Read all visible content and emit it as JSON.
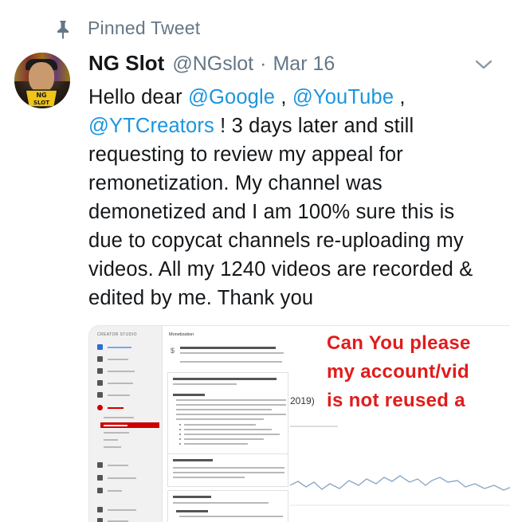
{
  "pinned": {
    "label": "Pinned Tweet",
    "icon": "pin-icon"
  },
  "tweet": {
    "author": {
      "name": "NG Slot",
      "handle": "@NGslot",
      "avatar_logo_text_top": "NG",
      "avatar_logo_text_bottom": "SLOT"
    },
    "separator": "·",
    "date": "Mar 16",
    "menu_icon": "chevron-down-icon",
    "text": {
      "greeting": "Hello dear ",
      "mention_1": "@Google",
      "sep_1": " , ",
      "mention_2": "@YouTube",
      "sep_2": " ,",
      "mention_3": "@YTCreators",
      "body": " ! 3 days later and still requesting to review my appeal for remonetization. My channel was demonetized and I am 100% sure this is due to copycat channels re-uploading my videos. All my 1240 videos are recorded & edited by me. Thank you"
    }
  },
  "media": {
    "sidebar_title": "CREATOR STUDIO",
    "main_heading": "Monetization",
    "year_label": "2019)",
    "overlay_lines": [
      "Can You please",
      "my account/vid",
      "is not reused a"
    ],
    "overlay_color": "#e01c1c"
  },
  "colors": {
    "link": "#1b95e0",
    "muted": "#657786",
    "text": "#14171a"
  }
}
